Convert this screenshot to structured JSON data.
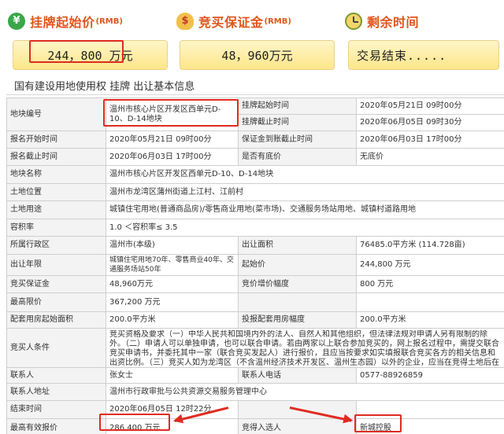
{
  "summary": {
    "start_price": {
      "label": "挂牌起始价",
      "unit": "(RMB)",
      "value": "244，800 万元",
      "icon": "price-icon"
    },
    "deposit": {
      "label": "竞买保证金",
      "unit": "(RMB)",
      "value": "48，960万元",
      "icon": "money-bag-icon"
    },
    "remaining": {
      "label": "剩余时间",
      "value": "交易结束.....",
      "icon": "clock-icon"
    }
  },
  "section_title": "国有建设用地使用权 挂牌 出让基本信息",
  "table": {
    "r1": {
      "k": "地块编号",
      "v": "温州市核心片区开发区西单元D-10、D-14地块",
      "k2a": "挂牌起始时间",
      "v2a": "2020年05月21日 09时00分",
      "k2b": "挂牌截止时间",
      "v2b": "2020年06月05日 09时30分"
    },
    "r2": {
      "k": "报名开始时间",
      "v": "2020年05月21日 09时00分",
      "k2": "保证金到账截止时间",
      "v2": "2020年06月03日 17时00分"
    },
    "r3": {
      "k": "报名截止时间",
      "v": "2020年06月03日 17时00分",
      "k2": "是否有底价",
      "v2": "无底价"
    },
    "r4": {
      "k": "地块名称",
      "v": "温州市核心片区开发区西单元D-10、D-14地块"
    },
    "r5": {
      "k": "土地位置",
      "v": "温州市龙湾区蒲州街道上江村、江前村"
    },
    "r6": {
      "k": "土地用途",
      "v": "城镇住宅用地(普通商品房)/零售商业用地(菜市场)、交通服务场站用地、城镇村道路用地"
    },
    "r7": {
      "k": "容积率",
      "v": "1.0 ＜容积率≤ 3.5"
    },
    "r8": {
      "k": "所属行政区",
      "v": "温州市(本级)",
      "k2": "出让面积",
      "v2": "76485.0平方米 (114.728亩)"
    },
    "r9": {
      "k": "出让年限",
      "v": "城镇住宅用地70年、零售商业40年、交通服务场站50年",
      "k2": "起始价",
      "v2": "244,800 万元"
    },
    "r10": {
      "k": "竞买保证金",
      "v": "48,960万元",
      "k2": "竞价增价幅度",
      "v2": "800 万元"
    },
    "r11": {
      "k": "最高限价",
      "v": "367,200 万元"
    },
    "r12": {
      "k": "配套用房起始面积",
      "v": "200.0平方米",
      "k2": "投报配套用房幅度",
      "v2": "200.0平方米"
    },
    "r13": {
      "k": "竞买人条件",
      "v": "竞买资格及要求（一）中华人民共和国境内外的法人、自然人和其他组织，但法律法规对申请人另有限制的除外。（二）申请人可以单独申请，也可以联合申请。若由两家以上联合参加竞买的，网上报名过程中，需提交联合竞买申请书，并委托其中一家（联合竞买发起人）进行报价，且应当按要求如实填报联合竞买各方的相关信息和出资比例。（三）竞买人如为龙湾区（不含温州经济技术开发区、温州生态园）以外的企业，应当在竞得土地后在龙湾区设立项目公司，并由项目公司负责土地开发建设。"
    },
    "r14": {
      "k": "联系人",
      "v": "张女士",
      "k2": "联系人电话",
      "v2": "0577-88926859"
    },
    "r15": {
      "k": "联系人地址",
      "v": "温州市行政审批与公共资源交易服务管理中心"
    },
    "r16": {
      "k": "结束时间",
      "v": "2020年06月05日 12时22分"
    },
    "r17": {
      "k": "最高有效报价",
      "v": "286,400 万元",
      "k2": "竞得入选人",
      "v2": "新城控股"
    }
  },
  "colors": {
    "accent": "#e0551c",
    "highlight": "#e02b20",
    "value_box": "#fde68a"
  }
}
